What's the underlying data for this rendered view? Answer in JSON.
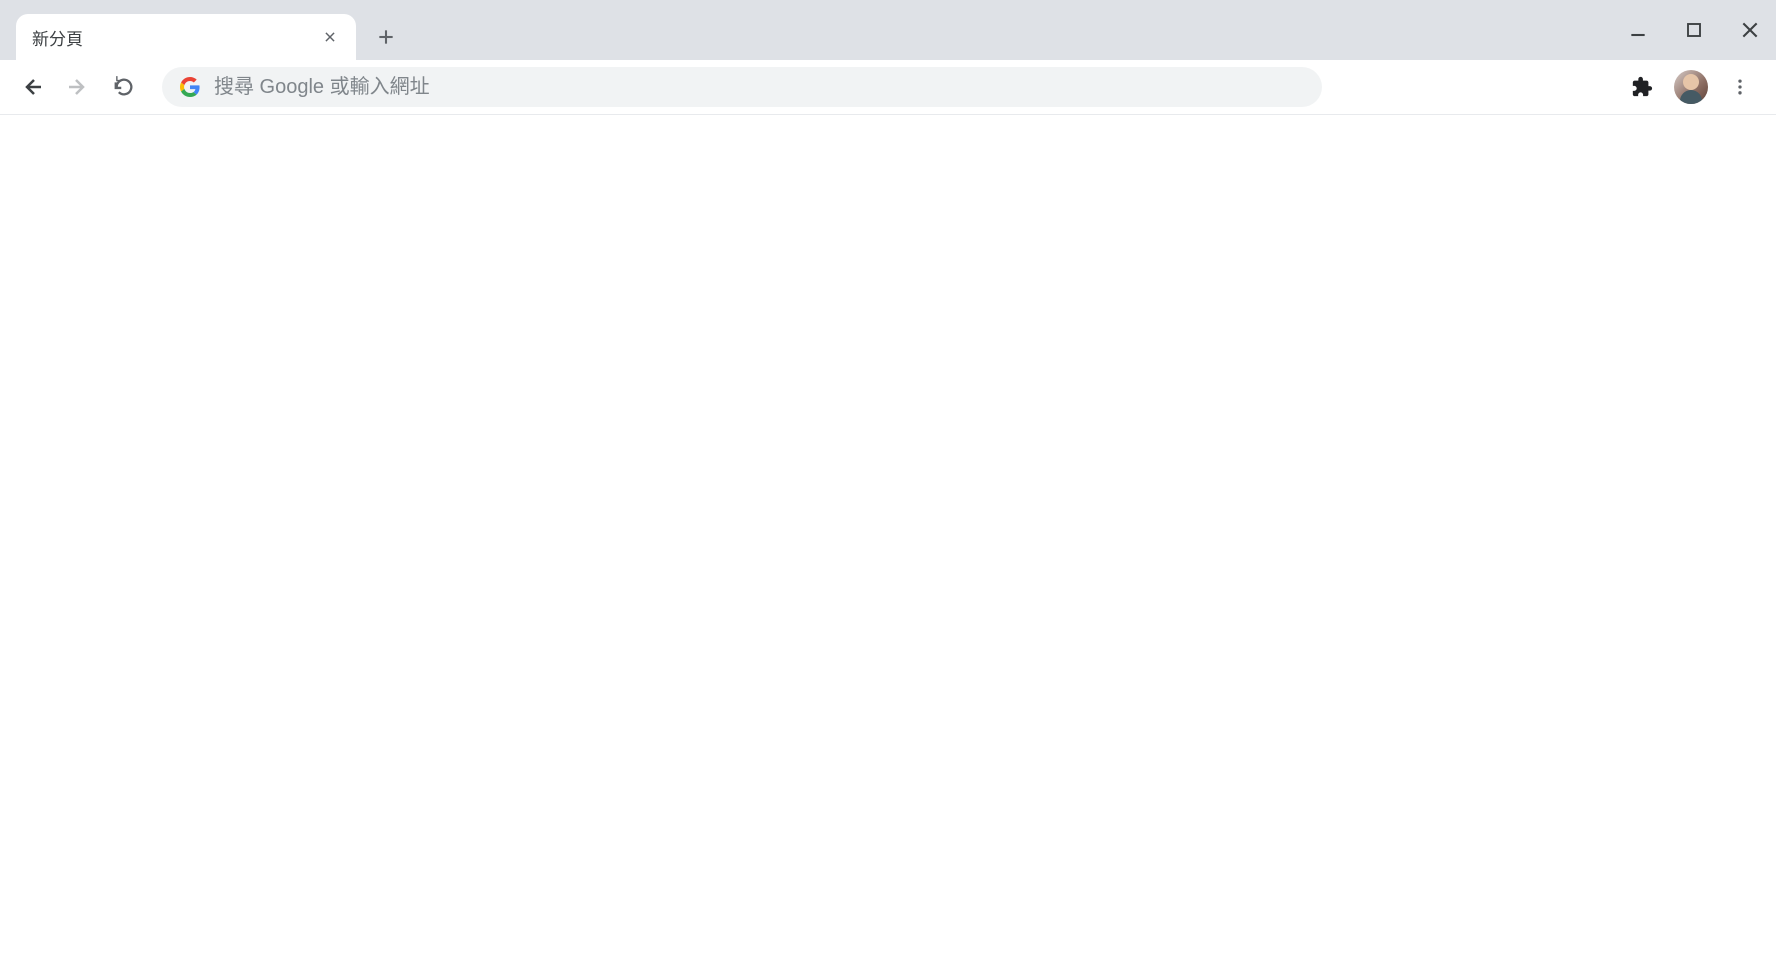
{
  "tabs": [
    {
      "title": "新分頁"
    }
  ],
  "omnibox": {
    "placeholder": "搜尋 Google 或輸入網址",
    "value": ""
  }
}
